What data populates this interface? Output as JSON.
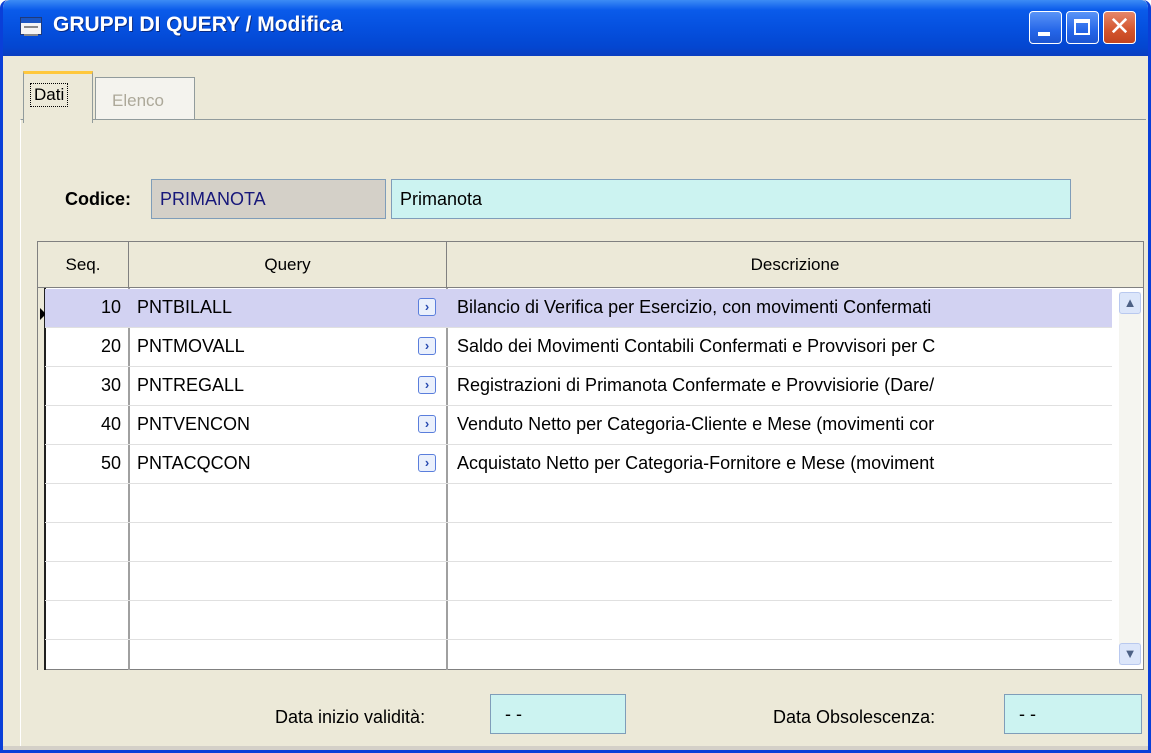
{
  "window": {
    "title": "GRUPPI DI QUERY / Modifica"
  },
  "tabs": [
    {
      "label": "Dati",
      "active": true
    },
    {
      "label": "Elenco",
      "active": false
    }
  ],
  "form": {
    "codice_label": "Codice:",
    "codice_value": "PRIMANOTA",
    "descrizione_value": "Primanota"
  },
  "grid": {
    "columns": [
      "Seq.",
      "Query",
      "Descrizione"
    ],
    "rows": [
      {
        "seq": "10",
        "query": "PNTBILALL",
        "descrizione": "Bilancio di Verifica per Esercizio, con movimenti Confermati"
      },
      {
        "seq": "20",
        "query": "PNTMOVALL",
        "descrizione": "Saldo dei Movimenti Contabili Confermati e Provvisori per C"
      },
      {
        "seq": "30",
        "query": "PNTREGALL",
        "descrizione": "Registrazioni di Primanota Confermate e Provvisiorie (Dare/"
      },
      {
        "seq": "40",
        "query": "PNTVENCON",
        "descrizione": "Venduto Netto per Categoria-Cliente e Mese (movimenti cor"
      },
      {
        "seq": "50",
        "query": "PNTACQCON",
        "descrizione": "Acquistato Netto per Categoria-Fornitore e Mese (moviment"
      }
    ],
    "selected_row": 0
  },
  "footer": {
    "inizio_label": "Data inizio validità:",
    "inizio_value": "- -",
    "obsolescenza_label": "Data Obsolescenza:",
    "obsolescenza_value": "- -"
  },
  "colors": {
    "titlebar": "#0550DF",
    "field_cyan": "#CCF3F1",
    "selected_row": "#D2D2F2",
    "tab_highlight": "#FFC83C"
  }
}
